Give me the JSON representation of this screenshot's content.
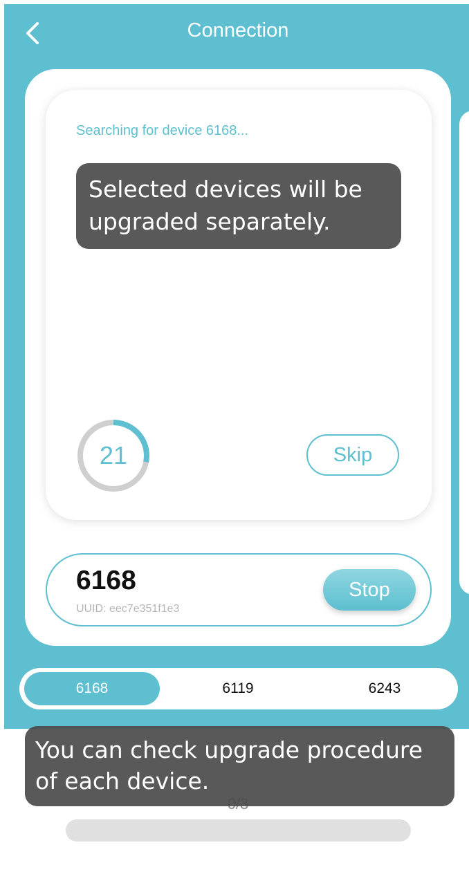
{
  "header": {
    "title": "Connection",
    "back_icon": "chevron-left-icon"
  },
  "search": {
    "status_text": "Searching for device 6168...",
    "countdown": "21",
    "countdown_progress": 0.28,
    "skip_label": "Skip"
  },
  "current_device": {
    "name": "6168",
    "uuid_text": "UUID: eec7e351f1e3",
    "stop_label": "Stop"
  },
  "device_tabs": [
    {
      "label": "6168",
      "active": true
    },
    {
      "label": "6119",
      "active": false
    },
    {
      "label": "6243",
      "active": false
    }
  ],
  "progress": {
    "text": "0/3",
    "fraction": 0
  },
  "tooltips": {
    "selected_devices": "Selected devices will be upgraded separately.",
    "check_procedure": "You can check upgrade procedure of each device."
  },
  "colors": {
    "accent": "#5dbfcf",
    "tooltip_bg": "#4b4b4b",
    "track": "#e0e0e0"
  }
}
